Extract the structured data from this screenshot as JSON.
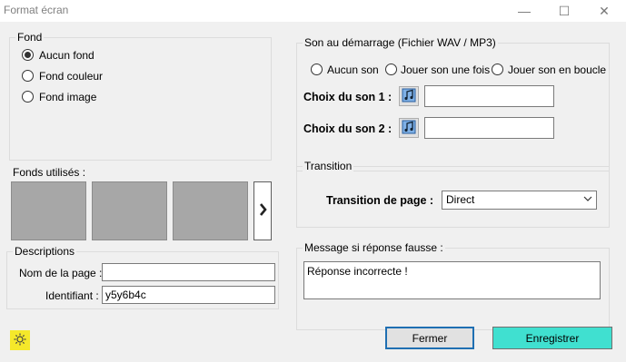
{
  "window": {
    "title": "Format écran",
    "minimize_glyph": "—",
    "maximize_glyph": "☐",
    "close_glyph": "✕"
  },
  "fond": {
    "group_label": "Fond",
    "options": [
      {
        "label": "Aucun fond",
        "selected": true
      },
      {
        "label": "Fond couleur",
        "selected": false
      },
      {
        "label": "Fond image",
        "selected": false
      }
    ]
  },
  "fonds_utilises": {
    "label": "Fonds utilisés  :",
    "next_icon": "chevron-right-icon"
  },
  "descriptions": {
    "group_label": "Descriptions",
    "page_name_label": "Nom de la page :",
    "page_name_value": "",
    "identifier_label": "Identifiant :",
    "identifier_value": "y5y6b4c"
  },
  "son": {
    "group_label": "Son au démarrage (Fichier WAV / MP3)",
    "options": [
      {
        "label": "Aucun son",
        "selected": false
      },
      {
        "label": "Jouer son une fois",
        "selected": false
      },
      {
        "label": "Jouer son en boucle",
        "selected": false
      }
    ],
    "choix1_label": "Choix du son 1 :",
    "choix1_value": "",
    "choix2_label": "Choix du son 2 :",
    "choix2_value": "",
    "sound_icon": "music-note-icon"
  },
  "transition": {
    "group_label": "Transition",
    "label": "Transition de page :",
    "selected": "Direct"
  },
  "message": {
    "group_label": "Message si réponse fausse :",
    "value": "Réponse incorrecte !"
  },
  "buttons": {
    "close_label": "Fermer",
    "save_label": "Enregistrer"
  },
  "colors": {
    "save_button_bg": "#40e0d0",
    "close_button_border": "#1f6fb2",
    "settings_icon_bg": "#f5e82a"
  }
}
